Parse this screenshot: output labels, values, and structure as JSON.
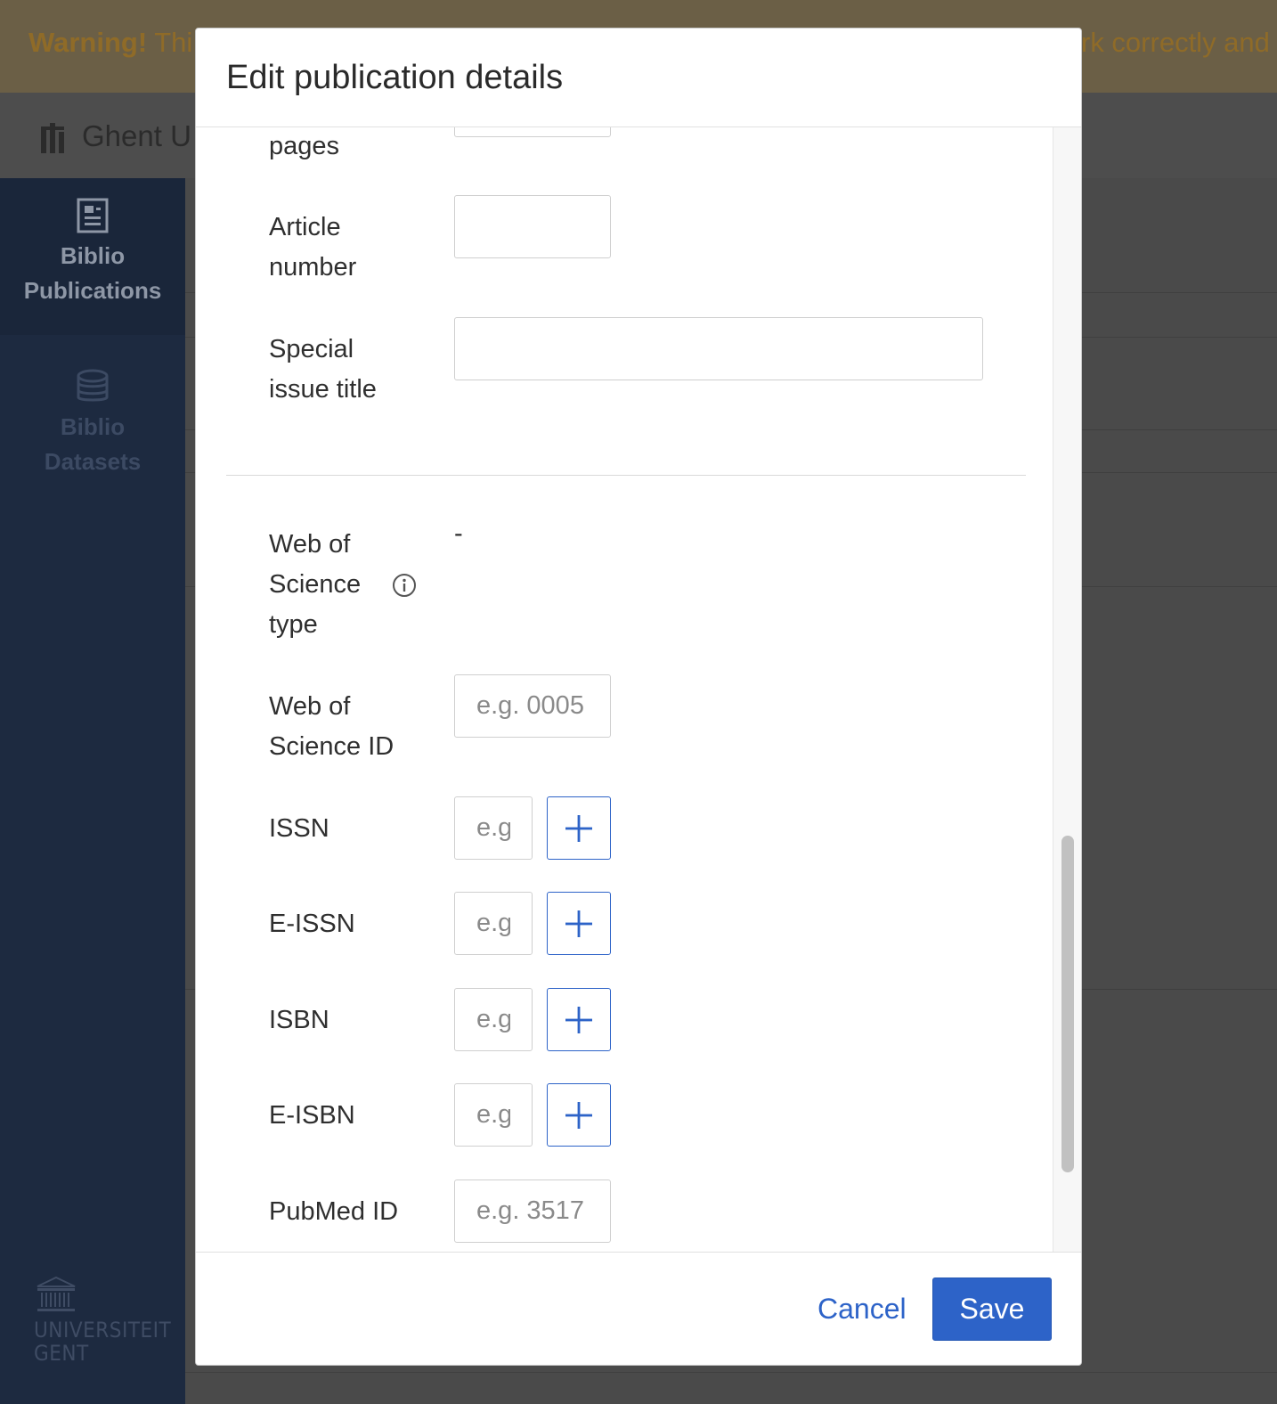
{
  "background": {
    "warning": {
      "strong": "Warning!",
      "text_start": " Thi",
      "text_end": "rk correctly and"
    },
    "brand": {
      "name": "Ghent U"
    },
    "sidebar": {
      "items": [
        {
          "label_line1": "Biblio",
          "label_line2": "Publications",
          "icon": "document-icon",
          "active": true
        },
        {
          "label_line1": "Biblio",
          "label_line2": "Datasets",
          "icon": "database-icon",
          "active": false
        }
      ],
      "logo_line1": "UNIVERSITEIT",
      "logo_line2": "GENT"
    }
  },
  "modal": {
    "title": "Edit publication details",
    "fields": {
      "pages": {
        "label": "pages"
      },
      "article_number": {
        "label_line1": "Article",
        "label_line2": "number",
        "value": ""
      },
      "special_issue_title": {
        "label_line1": "Special",
        "label_line2": "issue title",
        "value": ""
      },
      "wos_type": {
        "label_line1": "Web of",
        "label_line2": "Science",
        "label_line3": "type",
        "value": "-",
        "icon": "info-icon"
      },
      "wos_id": {
        "label_line1": "Web of",
        "label_line2": "Science ID",
        "placeholder": "e.g. 0005"
      },
      "issn": {
        "label": "ISSN",
        "placeholder": "e.g"
      },
      "eissn": {
        "label": "E-ISSN",
        "placeholder": "e.g"
      },
      "isbn": {
        "label": "ISBN",
        "placeholder": "e.g"
      },
      "eisbn": {
        "label": "E-ISBN",
        "placeholder": "e.g"
      },
      "pubmed_id": {
        "label": "PubMed ID",
        "placeholder": "e.g. 3517"
      }
    },
    "footer": {
      "cancel_label": "Cancel",
      "save_label": "Save"
    }
  },
  "colors": {
    "primary": "#2d63c8",
    "sidebar": "#1d2a40",
    "overlay": "#4a4a4a"
  }
}
